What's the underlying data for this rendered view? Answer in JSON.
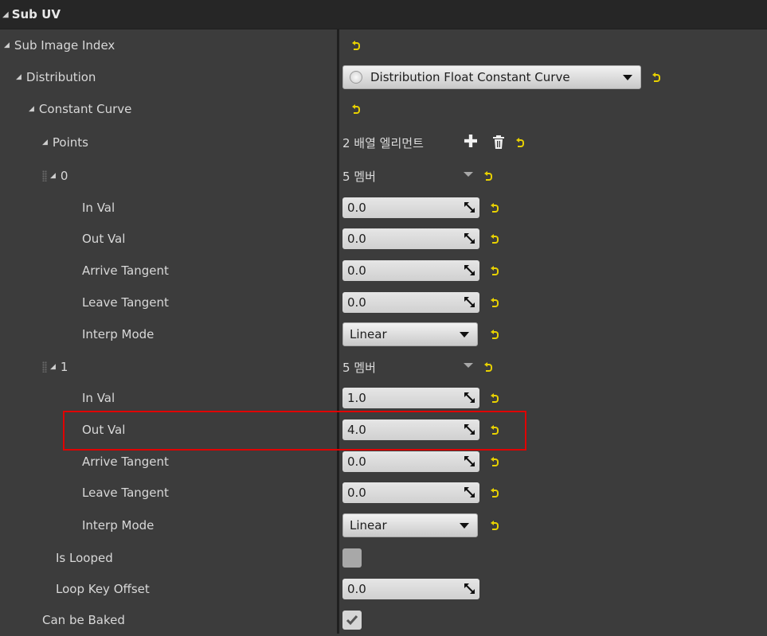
{
  "header": {
    "title": "Sub UV"
  },
  "rows": {
    "sub_image_index": {
      "label": "Sub Image Index"
    },
    "distribution": {
      "label": "Distribution",
      "value": "Distribution Float Constant Curve"
    },
    "constant_curve": {
      "label": "Constant Curve"
    },
    "points": {
      "label": "Points",
      "value": "2 배열 엘리먼트"
    },
    "point0": {
      "index": "0",
      "members": "5 멤버",
      "in_val": {
        "label": "In Val",
        "value": "0.0"
      },
      "out_val": {
        "label": "Out Val",
        "value": "0.0"
      },
      "arrive_tangent": {
        "label": "Arrive Tangent",
        "value": "0.0"
      },
      "leave_tangent": {
        "label": "Leave Tangent",
        "value": "0.0"
      },
      "interp_mode": {
        "label": "Interp Mode",
        "value": "Linear"
      }
    },
    "point1": {
      "index": "1",
      "members": "5 멤버",
      "in_val": {
        "label": "In Val",
        "value": "1.0"
      },
      "out_val": {
        "label": "Out Val",
        "value": "4.0"
      },
      "arrive_tangent": {
        "label": "Arrive Tangent",
        "value": "0.0"
      },
      "leave_tangent": {
        "label": "Leave Tangent",
        "value": "0.0"
      },
      "interp_mode": {
        "label": "Interp Mode",
        "value": "Linear"
      }
    },
    "is_looped": {
      "label": "Is Looped",
      "checked": false
    },
    "loop_key_offset": {
      "label": "Loop Key Offset",
      "value": "0.0"
    },
    "can_be_baked": {
      "label": "Can be Baked",
      "checked": true
    }
  },
  "colors": {
    "background": "#3c3c3c",
    "header": "#262626",
    "reset_arrow": "#e8d100",
    "highlight": "#e00000"
  }
}
